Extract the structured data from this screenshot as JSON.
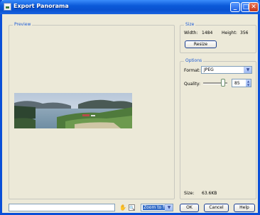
{
  "window": {
    "title": "Export Panorama"
  },
  "preview": {
    "legend": "Preview"
  },
  "size": {
    "legend": "Size",
    "width_label": "Width:",
    "width_value": "1484",
    "height_label": "Height:",
    "height_value": "356",
    "resize_label": "Resize"
  },
  "options": {
    "legend": "Options",
    "format_label": "Format:",
    "format_value": "JPEG",
    "quality_label": "Quality:",
    "quality_value": "85",
    "size_label": "Size:",
    "size_value": "63.6KB"
  },
  "footer": {
    "filename_value": "",
    "zoom_value": "Zoom to fit",
    "ok_label": "OK",
    "cancel_label": "Cancel",
    "help_label": "Help"
  },
  "colors": {
    "title_bar": "#0b5ad9",
    "accent": "#1c5bd6",
    "face": "#ece9d8"
  }
}
